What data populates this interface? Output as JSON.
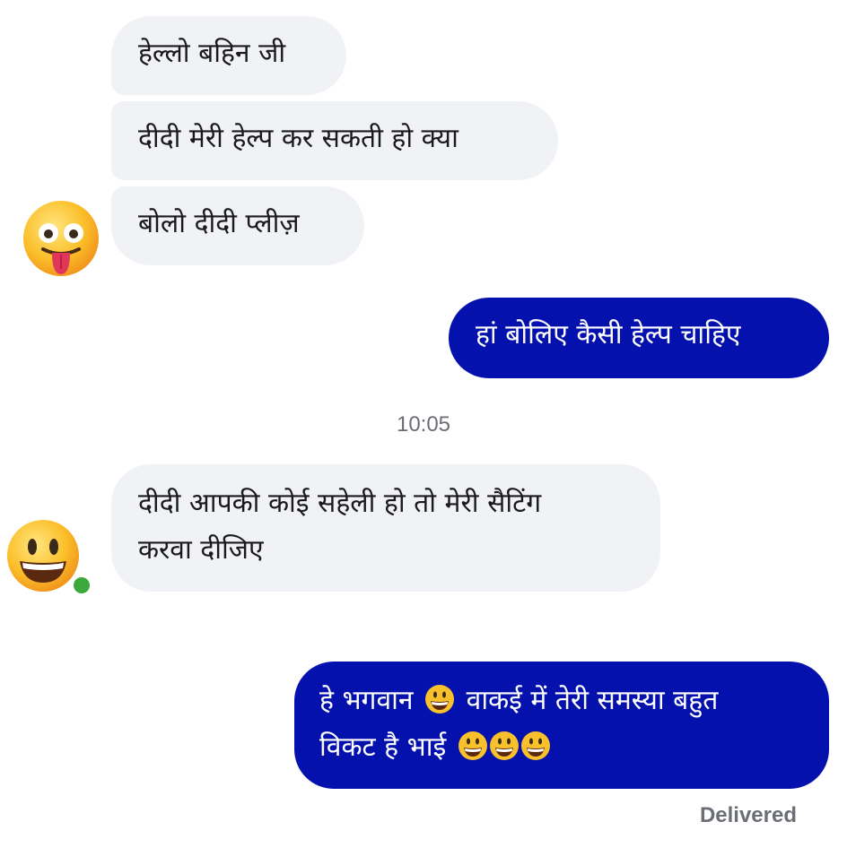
{
  "conversation": {
    "messages": [
      {
        "direction": "incoming",
        "text": "हेल्लो बहिन जी"
      },
      {
        "direction": "incoming",
        "text": "दीदी मेरी हेल्प कर सकती हो क्या"
      },
      {
        "direction": "incoming",
        "text": "बोलो दीदी प्लीज़"
      },
      {
        "direction": "outgoing",
        "text": "हां बोलिए कैसी हेल्प चाहिए"
      },
      {
        "direction": "incoming",
        "lines": [
          "दीदी आपकी कोई सहेली हो तो मेरी सैटिंग",
          "करवा दीजिए"
        ]
      },
      {
        "direction": "outgoing",
        "line1_a": "हे भगवान",
        "line1_b": "वाकई में तेरी समस्या बहुत",
        "line2": "विकट है भाई"
      }
    ],
    "timestamp": "10:05",
    "delivery_status": "Delivered"
  },
  "avatars": {
    "first": "tongue-out-emoji-icon",
    "second": "grinning-emoji-icon",
    "online_indicator_color": "#3aa83a"
  },
  "colors": {
    "incoming_bubble": "#f1f2f6",
    "outgoing_bubble": "#0511ad",
    "meta_text": "#6b6e75"
  }
}
